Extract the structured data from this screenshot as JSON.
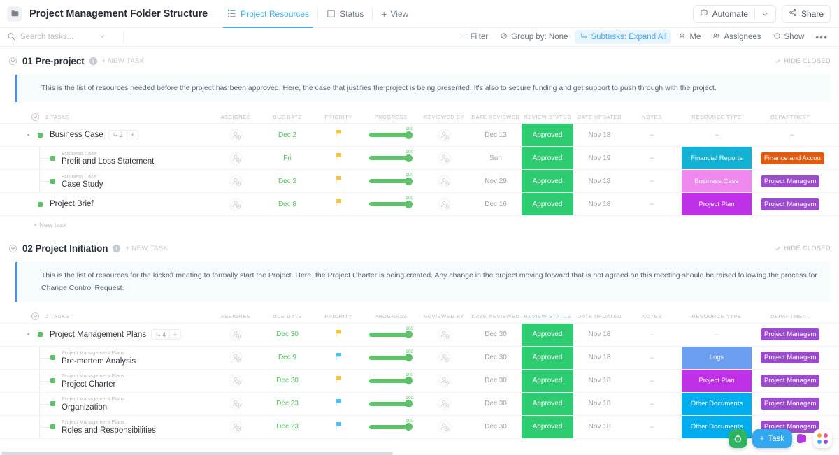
{
  "topbar": {
    "folder_icon": "folder-icon",
    "title": "Project Management Folder Structure",
    "tabs": [
      {
        "label": "Project Resources",
        "icon": "list-view-icon",
        "active": true
      },
      {
        "label": "Status",
        "icon": "board-view-icon",
        "active": false
      }
    ],
    "add_view_label": "View",
    "automate_label": "Automate",
    "share_label": "Share"
  },
  "filterbar": {
    "search_placeholder": "Search tasks...",
    "search_value": "",
    "items": [
      {
        "label": "Filter",
        "icon": "filter-icon",
        "highlight": false
      },
      {
        "label": "Group by: None",
        "icon": "group-icon",
        "highlight": false
      },
      {
        "label": "Subtasks: Expand All",
        "icon": "subtask-icon",
        "highlight": true
      },
      {
        "label": "Me",
        "icon": "person-icon",
        "highlight": false
      },
      {
        "label": "Assignees",
        "icon": "people-icon",
        "highlight": false
      },
      {
        "label": "Show",
        "icon": "eye-icon",
        "highlight": false
      }
    ],
    "more_label": "•••"
  },
  "columns": [
    "ASSIGNEE",
    "DUE DATE",
    "PRIORITY",
    "PROGRESS",
    "REVIEWED BY",
    "DATE REVIEWED",
    "REVIEW STATUS",
    "DATE UPDATED",
    "NOTES",
    "RESOURCE TYPE",
    "DEPARTMENT"
  ],
  "common": {
    "new_task_caps": "+ NEW TASK",
    "hide_closed": "HIDE CLOSED",
    "new_task": "+ New task",
    "dash": "–",
    "progress_label": "100"
  },
  "colors": {
    "approved_green": "#2ecc71",
    "progress_green": "#5ec26a",
    "accent_blue": "#49a8f0",
    "financial_reports": "#13b2d4",
    "business_case": "#ef88ef",
    "project_plan": "#c030e8",
    "logs": "#6c9ff0",
    "other_documents": "#00aeef",
    "finance_dept": "#e05a10",
    "pm_dept": "#9c4bcf"
  },
  "sections": [
    {
      "index": "01",
      "title": "01 Pre-project",
      "description": "This is the list of resources needed before the project has been approved. Here, the case that justifies the project is being presented. It's also to secure funding and get support to push through with the project.",
      "task_count_label": "2 TASKS",
      "rows": [
        {
          "level": "parent",
          "name": "Business Case",
          "parent_label": "",
          "subtask_count": "2",
          "due": "Dec 2",
          "due_color": "green",
          "priority": "yellow",
          "progress": 100,
          "date_reviewed": "Dec 13",
          "review_status": "Approved",
          "date_updated": "Nov 18",
          "notes": "–",
          "resource_type": "",
          "resource_color": "",
          "department": "",
          "department_color": ""
        },
        {
          "level": "child",
          "name": "Profit and Loss Statement",
          "parent_label": "Business Case",
          "subtask_count": "",
          "due": "Fri",
          "due_color": "green",
          "priority": "yellow",
          "progress": 100,
          "date_reviewed": "Sun",
          "review_status": "Approved",
          "date_updated": "Nov 19",
          "notes": "–",
          "resource_type": "Financial Reports",
          "resource_color": "#13b2d4",
          "department": "Finance and Accou",
          "department_color": "#e05a10"
        },
        {
          "level": "child",
          "name": "Case Study",
          "parent_label": "Business Case",
          "subtask_count": "",
          "due": "Dec 2",
          "due_color": "green",
          "priority": "yellow",
          "progress": 100,
          "date_reviewed": "Nov 29",
          "review_status": "Approved",
          "date_updated": "Nov 18",
          "notes": "–",
          "resource_type": "Business Case",
          "resource_color": "#ef88ef",
          "department": "Project Managem",
          "department_color": "#9c4bcf"
        },
        {
          "level": "parent-plain",
          "name": "Project Brief",
          "parent_label": "",
          "subtask_count": "",
          "due": "Dec 8",
          "due_color": "green",
          "priority": "yellow",
          "progress": 100,
          "date_reviewed": "Dec 16",
          "review_status": "Approved",
          "date_updated": "Nov 18",
          "notes": "–",
          "resource_type": "Project Plan",
          "resource_color": "#c030e8",
          "department": "Project Managem",
          "department_color": "#9c4bcf"
        }
      ]
    },
    {
      "index": "02",
      "title": "02 Project Initiation",
      "description": "This is the list of resources for the kickoff meeting to formally start the Project. Here. the Project Charter is being created. Any change in the project moving forward that is not agreed on this meeting should be raised following the process for Change Control Request.",
      "task_count_label": "2 TASKS",
      "rows": [
        {
          "level": "parent",
          "name": "Project Management Plans",
          "parent_label": "",
          "subtask_count": "4",
          "due": "Dec 30",
          "due_color": "green",
          "priority": "yellow",
          "progress": 100,
          "date_reviewed": "Dec 30",
          "review_status": "Approved",
          "date_updated": "Nov 18",
          "notes": "–",
          "resource_type": "",
          "resource_color": "",
          "department": "Project Managem",
          "department_color": "#9c4bcf"
        },
        {
          "level": "child",
          "name": "Pre-mortem Analysis",
          "parent_label": "Project Management Plans",
          "subtask_count": "",
          "due": "Dec 9",
          "due_color": "green",
          "priority": "blue",
          "progress": 100,
          "date_reviewed": "Dec 30",
          "review_status": "Approved",
          "date_updated": "Nov 18",
          "notes": "–",
          "resource_type": "Logs",
          "resource_color": "#6c9ff0",
          "department": "Project Managem",
          "department_color": "#9c4bcf"
        },
        {
          "level": "child",
          "name": "Project Charter",
          "parent_label": "Project Management Plans",
          "subtask_count": "",
          "due": "Dec 30",
          "due_color": "green",
          "priority": "yellow",
          "progress": 100,
          "date_reviewed": "Dec 30",
          "review_status": "Approved",
          "date_updated": "Nov 18",
          "notes": "–",
          "resource_type": "Project Plan",
          "resource_color": "#c030e8",
          "department": "Project Managem",
          "department_color": "#9c4bcf"
        },
        {
          "level": "child",
          "name": "Organization",
          "parent_label": "Project Management Plans",
          "subtask_count": "",
          "due": "Dec 23",
          "due_color": "green",
          "priority": "blue",
          "progress": 100,
          "date_reviewed": "Dec 30",
          "review_status": "Approved",
          "date_updated": "Nov 18",
          "notes": "–",
          "resource_type": "Other Documents",
          "resource_color": "#00aeef",
          "department": "Project Managem",
          "department_color": "#9c4bcf"
        },
        {
          "level": "child",
          "name": "Roles and Responsibilities",
          "parent_label": "Project Management Plans",
          "subtask_count": "",
          "due": "Dec 23",
          "due_color": "green",
          "priority": "blue",
          "progress": 100,
          "date_reviewed": "Dec 30",
          "review_status": "Approved",
          "date_updated": "Nov 18",
          "notes": "–",
          "resource_type": "Other Documents",
          "resource_color": "#00aeef",
          "department": "Project Managem",
          "department_color": "#9c4bcf"
        }
      ]
    }
  ],
  "fab": {
    "timer_icon": "timer-icon",
    "task_label": "Task",
    "grid_icon": "apps-grid-icon"
  }
}
